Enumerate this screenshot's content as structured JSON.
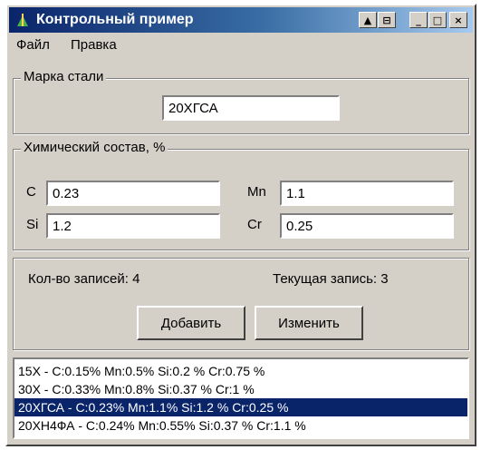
{
  "window": {
    "title": "Контрольный пример",
    "controls": {
      "pin1": "▲",
      "pin2": "⊟",
      "minimize": "_",
      "maximize": "□",
      "close": "×"
    }
  },
  "menu": {
    "items": [
      "Файл",
      "Правка"
    ]
  },
  "steel": {
    "legend": "Марка стали",
    "value": "20ХГСА"
  },
  "chem": {
    "legend": "Химический состав, %",
    "fields": [
      {
        "label": "C",
        "value": "0.23"
      },
      {
        "label": "Mn",
        "value": "1.1"
      },
      {
        "label": "Si",
        "value": "1.2"
      },
      {
        "label": "Cr",
        "value": "0.25"
      }
    ]
  },
  "records": {
    "count_label": "Кол-во записей: 4",
    "current_label": "Текущая запись: 3",
    "add_button": "Добавить",
    "edit_button": "Изменить"
  },
  "list": {
    "selected_index": 2,
    "items": [
      "15Х - C:0.15% Mn:0.5% Si:0.2 % Cr:0.75 %",
      "30Х - C:0.33% Mn:0.8% Si:0.37 % Cr:1 %",
      "20ХГСА - C:0.23% Mn:1.1% Si:1.2 % Cr:0.25 %",
      "20ХН4ФА - C:0.24% Mn:0.55% Si:0.37 % Cr:1.1 %"
    ]
  },
  "colors": {
    "title_start": "#0a246a",
    "title_end": "#a6caf0",
    "face": "#d4d0c8",
    "selection": "#0a246a"
  }
}
